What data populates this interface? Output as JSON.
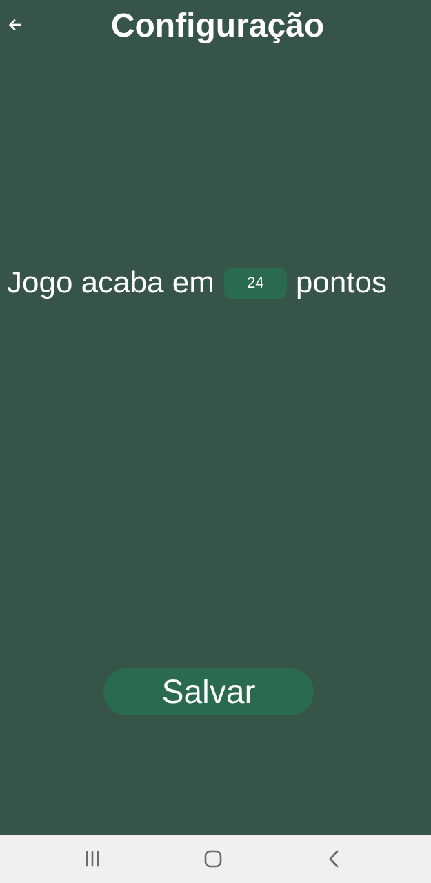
{
  "header": {
    "back_icon": "arrow-left-icon",
    "title": "Configuração"
  },
  "setting": {
    "prefix": "Jogo acaba em",
    "points_value": "24",
    "suffix": "pontos"
  },
  "actions": {
    "save_label": "Salvar"
  },
  "nav": {
    "recents_icon": "recents-icon",
    "home_icon": "home-icon",
    "back_icon": "chevron-left-icon"
  },
  "colors": {
    "background": "#375448",
    "accent": "#2a6a4e",
    "text": "#ffffff",
    "nav_bar": "#f0f0f0",
    "nav_icon": "#6b6b6b"
  }
}
